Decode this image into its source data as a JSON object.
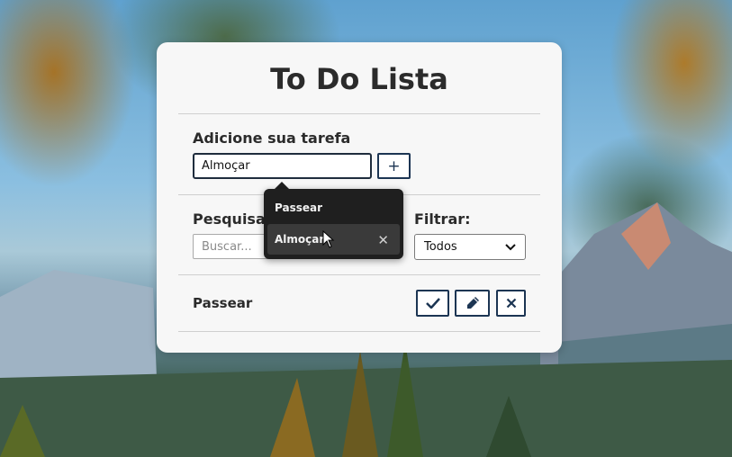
{
  "app": {
    "title": "To Do Lista"
  },
  "add_section": {
    "label": "Adicione sua tarefa",
    "input_value": "Almoçar",
    "add_button_label": "+"
  },
  "autocomplete": {
    "items": [
      {
        "label": "Passear"
      },
      {
        "label": "Almoçar",
        "remove_label": "✕"
      }
    ]
  },
  "search_section": {
    "label": "Pesquisa",
    "placeholder": "Buscar..."
  },
  "filter_section": {
    "label": "Filtrar:",
    "selected": "Todos"
  },
  "todos": [
    {
      "title": "Passear"
    }
  ],
  "colors": {
    "accent": "#1c3553",
    "card_bg": "#f7f7f7"
  }
}
